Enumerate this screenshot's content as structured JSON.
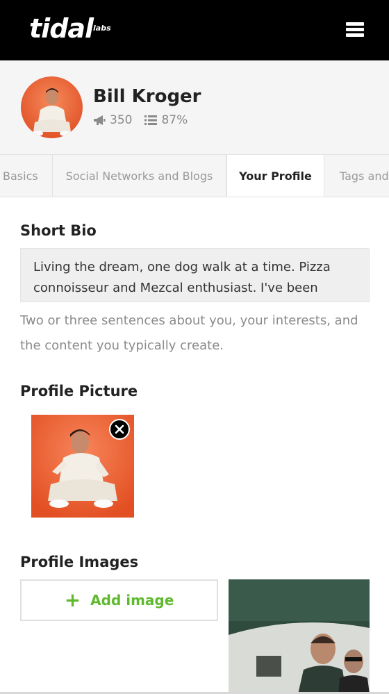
{
  "header": {
    "logo_text": "tidal",
    "logo_sup": "labs",
    "menu_icon": "hamburger-menu-icon"
  },
  "profile": {
    "name": "Bill Kroger",
    "stats": [
      {
        "icon": "megaphone-icon",
        "value": "350"
      },
      {
        "icon": "list-icon",
        "value": "87%"
      }
    ]
  },
  "tabs": [
    {
      "label": "Basics",
      "active": false
    },
    {
      "label": "Social Networks and Blogs",
      "active": false
    },
    {
      "label": "Your Profile",
      "active": true
    },
    {
      "label": "Tags and",
      "active": false
    }
  ],
  "short_bio": {
    "heading": "Short Bio",
    "value": "Living the dream, one dog walk at a time. Pizza connoisseur and Mezcal enthusiast. I've been",
    "help": "Two or three sentences about you, your interests, and the content you typically create."
  },
  "profile_picture": {
    "heading": "Profile Picture",
    "remove_icon": "close-icon"
  },
  "profile_images": {
    "heading": "Profile Images",
    "add_label": "Add image",
    "add_icon": "plus-icon"
  },
  "colors": {
    "header_bg": "#000000",
    "accent_green": "#5fb92e",
    "photo_orange": "#f26a3c"
  }
}
